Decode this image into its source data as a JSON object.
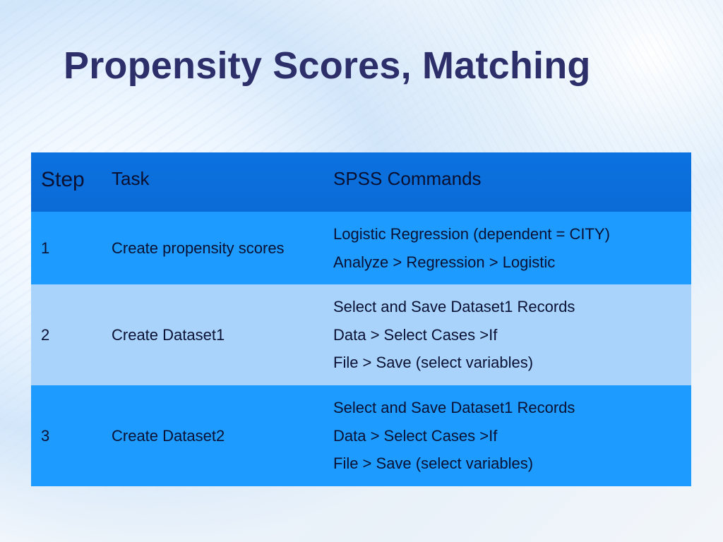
{
  "title": "Propensity Scores, Matching",
  "table": {
    "headers": {
      "step": "Step",
      "task": "Task",
      "commands": "SPSS Commands"
    },
    "rows": [
      {
        "step": "1",
        "task": "Create propensity scores",
        "cmd1": "Logistic Regression (dependent = CITY)",
        "cmd2": "Analyze > Regression > Logistic",
        "cmd3": ""
      },
      {
        "step": "2",
        "task": "Create Dataset1",
        "cmd1": "Select and Save Dataset1 Records",
        "cmd2": "Data > Select Cases >If",
        "cmd3": "File > Save (select variables)"
      },
      {
        "step": "3",
        "task": "Create Dataset2",
        "cmd1": "Select and Save Dataset1 Records",
        "cmd2": "Data > Select Cases >If",
        "cmd3": "File > Save (select variables)"
      }
    ]
  }
}
